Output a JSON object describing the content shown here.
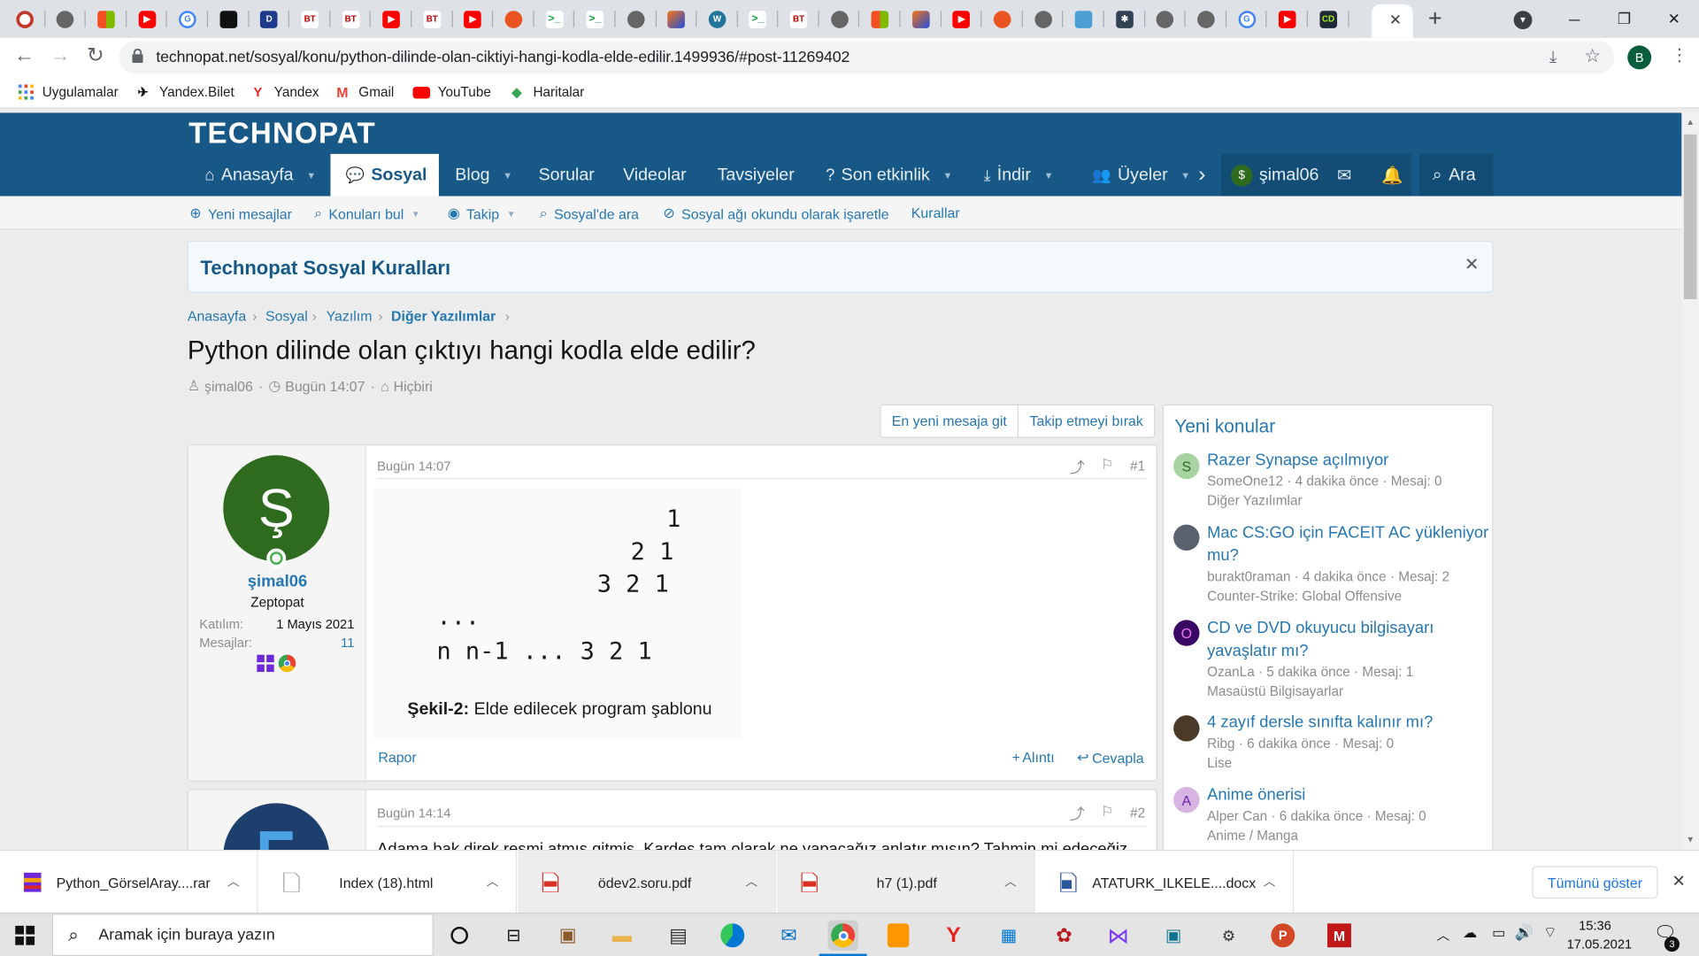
{
  "browser": {
    "url": "technopat.net/sosyal/konu/python-dilinde-olan-ciktiyi-hangi-kodla-elde-edilir.1499936/#post-11269402",
    "profile_initial": "B",
    "tab_labels": [
      "BT",
      "BT",
      "BT",
      "BT",
      "CD"
    ],
    "active_tab_label": "",
    "bookmarks": [
      "Uygulamalar",
      "Yandex.Bilet",
      "Yandex",
      "Gmail",
      "YouTube",
      "Haritalar"
    ]
  },
  "site": {
    "logo": "TECHNOPAT",
    "nav": {
      "home": "Anasayfa",
      "social": "Sosyal",
      "blog": "Blog",
      "questions": "Sorular",
      "videos": "Videolar",
      "recommendations": "Tavsiyeler",
      "activity": "Son etkinlik",
      "download": "İndir",
      "members": "Üyeler",
      "user": "şimal06",
      "search": "Ara"
    },
    "subnav": {
      "new_messages": "Yeni mesajlar",
      "find_threads": "Konuları bul",
      "follow": "Takip",
      "search_social": "Sosyal'de ara",
      "mark_read": "Sosyal ağı okundu olarak işaretle",
      "rules": "Kurallar"
    }
  },
  "notice": {
    "title": "Technopat Sosyal Kuralları"
  },
  "breadcrumb": [
    "Anasayfa",
    "Sosyal",
    "Yazılım",
    "Diğer Yazılımlar"
  ],
  "thread": {
    "title": "Python dilinde olan çıktıyı hangi kodla elde edilir?",
    "author": "şimal06",
    "time": "Bugün 14:07",
    "tags": "Hiçbiri",
    "btn_latest": "En yeni mesaja git",
    "btn_unfollow": "Takip etmeyi bırak"
  },
  "post1": {
    "avatar_letter": "Ş",
    "username": "şimal06",
    "rank": "Zeptopat",
    "joined_label": "Katılım:",
    "joined_value": "1 Mayıs 2021",
    "messages_label": "Mesajlar:",
    "messages_value": "11",
    "time": "Bugün 14:07",
    "number": "#1",
    "code_lines": [
      "1",
      "2 1",
      "3 2 1",
      "...",
      "n n-1 ... 3 2 1"
    ],
    "caption_bold": "Şekil-2:",
    "caption": "Elde edilecek program şablonu",
    "report": "Rapor",
    "quote": "Alıntı",
    "reply": "Cevapla"
  },
  "post2": {
    "time": "Bugün 14:14",
    "number": "#2",
    "text": "Adama bak direk resmi atmış gitmiş. Kardeş tam olarak ne yapacağız anlatır mısın? Tahmin mi edeceğiz"
  },
  "sidebar": {
    "title": "Yeni konular",
    "items": [
      {
        "avatar": "S",
        "title": "Razer Synapse açılmıyor",
        "meta": "SomeOne12 · 4 dakika önce · Mesaj: 0",
        "forum": "Diğer Yazılımlar"
      },
      {
        "avatar": "",
        "title": "Mac CS:GO için FACEIT AC yükleniyor mu?",
        "meta": "burakt0raman · 4 dakika önce · Mesaj: 2",
        "forum": "Counter-Strike: Global Offensive"
      },
      {
        "avatar": "O",
        "title": "CD ve DVD okuyucu bilgisayarı yavaşlatır mı?",
        "meta": "OzanLa · 5 dakika önce · Mesaj: 1",
        "forum": "Masaüstü Bilgisayarlar"
      },
      {
        "avatar": "",
        "title": "4 zayıf dersle sınıfta kalınır mı?",
        "meta": "Ribg · 6 dakika önce · Mesaj: 0",
        "forum": "Lise"
      },
      {
        "avatar": "A",
        "title": "Anime önerisi",
        "meta": "Alper Can · 6 dakika önce · Mesaj: 0",
        "forum": "Anime / Manga"
      }
    ]
  },
  "downloads": {
    "items": [
      "Python_GörselAray....rar",
      "Index (18).html",
      "ödev2.soru.pdf",
      "h7 (1).pdf",
      "ATATURK_ILKELE....docx"
    ],
    "show_all": "Tümünü göster"
  },
  "taskbar": {
    "search_placeholder": "Aramak için buraya yazın",
    "time": "15:36",
    "date": "17.05.2021",
    "notifications": "3"
  },
  "colors": {
    "brand": "#185886",
    "link": "#2577b1",
    "avatar_green": "#2f6b1f"
  }
}
